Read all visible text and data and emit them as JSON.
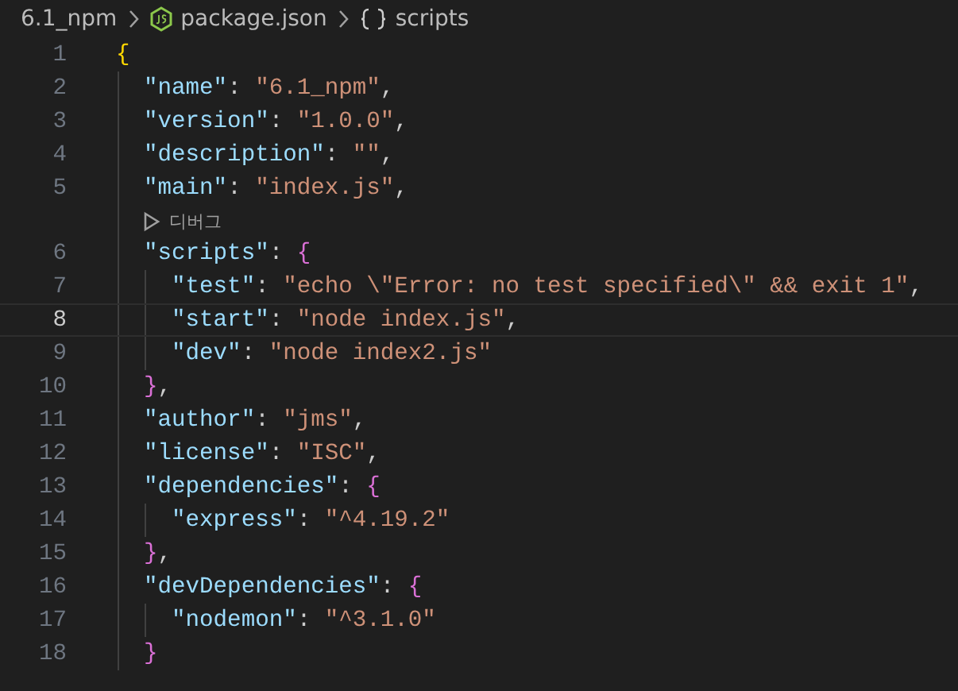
{
  "breadcrumb": [
    {
      "kind": "folder",
      "label": "6.1_npm"
    },
    {
      "kind": "json-file",
      "label": "package.json"
    },
    {
      "kind": "object",
      "label": "scripts"
    }
  ],
  "lines": [
    {
      "kind": "code",
      "number": "1",
      "current": false,
      "tokens": [
        {
          "kind": "brace1",
          "text": "{"
        }
      ]
    },
    {
      "kind": "code",
      "number": "2",
      "current": false,
      "tokens": [
        {
          "kind": "key",
          "text": "  \"name\""
        },
        {
          "kind": "punct",
          "text": ": "
        },
        {
          "kind": "string",
          "text": "\"6.1_npm\""
        },
        {
          "kind": "punct",
          "text": ","
        }
      ]
    },
    {
      "kind": "code",
      "number": "3",
      "current": false,
      "tokens": [
        {
          "kind": "key",
          "text": "  \"version\""
        },
        {
          "kind": "punct",
          "text": ": "
        },
        {
          "kind": "string",
          "text": "\"1.0.0\""
        },
        {
          "kind": "punct",
          "text": ","
        }
      ]
    },
    {
      "kind": "code",
      "number": "4",
      "current": false,
      "tokens": [
        {
          "kind": "key",
          "text": "  \"description\""
        },
        {
          "kind": "punct",
          "text": ": "
        },
        {
          "kind": "string",
          "text": "\"\""
        },
        {
          "kind": "punct",
          "text": ","
        }
      ]
    },
    {
      "kind": "code",
      "number": "5",
      "current": false,
      "tokens": [
        {
          "kind": "key",
          "text": "  \"main\""
        },
        {
          "kind": "punct",
          "text": ": "
        },
        {
          "kind": "string",
          "text": "\"index.js\""
        },
        {
          "kind": "punct",
          "text": ","
        }
      ]
    },
    {
      "kind": "codelens",
      "label": "디버그"
    },
    {
      "kind": "code",
      "number": "6",
      "current": false,
      "tokens": [
        {
          "kind": "key",
          "text": "  \"scripts\""
        },
        {
          "kind": "punct",
          "text": ": "
        },
        {
          "kind": "brace2",
          "text": "{"
        }
      ]
    },
    {
      "kind": "code",
      "number": "7",
      "current": false,
      "tokens": [
        {
          "kind": "key",
          "text": "    \"test\""
        },
        {
          "kind": "punct",
          "text": ": "
        },
        {
          "kind": "string",
          "text": "\"echo \\\"Error: no test specified\\\" && exit 1\""
        },
        {
          "kind": "punct",
          "text": ","
        }
      ]
    },
    {
      "kind": "code",
      "number": "8",
      "current": true,
      "tokens": [
        {
          "kind": "key",
          "text": "    \"start\""
        },
        {
          "kind": "punct",
          "text": ": "
        },
        {
          "kind": "string",
          "text": "\"node index.js\""
        },
        {
          "kind": "punct",
          "text": ","
        }
      ]
    },
    {
      "kind": "code",
      "number": "9",
      "current": false,
      "tokens": [
        {
          "kind": "key",
          "text": "    \"dev\""
        },
        {
          "kind": "punct",
          "text": ": "
        },
        {
          "kind": "string",
          "text": "\"node index2.js\""
        }
      ]
    },
    {
      "kind": "code",
      "number": "10",
      "current": false,
      "tokens": [
        {
          "kind": "brace2",
          "text": "  }"
        },
        {
          "kind": "punct",
          "text": ","
        }
      ]
    },
    {
      "kind": "code",
      "number": "11",
      "current": false,
      "tokens": [
        {
          "kind": "key",
          "text": "  \"author\""
        },
        {
          "kind": "punct",
          "text": ": "
        },
        {
          "kind": "string",
          "text": "\"jms\""
        },
        {
          "kind": "punct",
          "text": ","
        }
      ]
    },
    {
      "kind": "code",
      "number": "12",
      "current": false,
      "tokens": [
        {
          "kind": "key",
          "text": "  \"license\""
        },
        {
          "kind": "punct",
          "text": ": "
        },
        {
          "kind": "string",
          "text": "\"ISC\""
        },
        {
          "kind": "punct",
          "text": ","
        }
      ]
    },
    {
      "kind": "code",
      "number": "13",
      "current": false,
      "tokens": [
        {
          "kind": "key",
          "text": "  \"dependencies\""
        },
        {
          "kind": "punct",
          "text": ": "
        },
        {
          "kind": "brace2",
          "text": "{"
        }
      ]
    },
    {
      "kind": "code",
      "number": "14",
      "current": false,
      "tokens": [
        {
          "kind": "key",
          "text": "    \"express\""
        },
        {
          "kind": "punct",
          "text": ": "
        },
        {
          "kind": "string",
          "text": "\"^4.19.2\""
        }
      ]
    },
    {
      "kind": "code",
      "number": "15",
      "current": false,
      "tokens": [
        {
          "kind": "brace2",
          "text": "  }"
        },
        {
          "kind": "punct",
          "text": ","
        }
      ]
    },
    {
      "kind": "code",
      "number": "16",
      "current": false,
      "tokens": [
        {
          "kind": "key",
          "text": "  \"devDependencies\""
        },
        {
          "kind": "punct",
          "text": ": "
        },
        {
          "kind": "brace2",
          "text": "{"
        }
      ]
    },
    {
      "kind": "code",
      "number": "17",
      "current": false,
      "tokens": [
        {
          "kind": "key",
          "text": "    \"nodemon\""
        },
        {
          "kind": "punct",
          "text": ": "
        },
        {
          "kind": "string",
          "text": "\"^3.1.0\""
        }
      ]
    },
    {
      "kind": "code",
      "number": "18",
      "current": false,
      "tokens": [
        {
          "kind": "brace2",
          "text": "  }"
        }
      ]
    }
  ]
}
